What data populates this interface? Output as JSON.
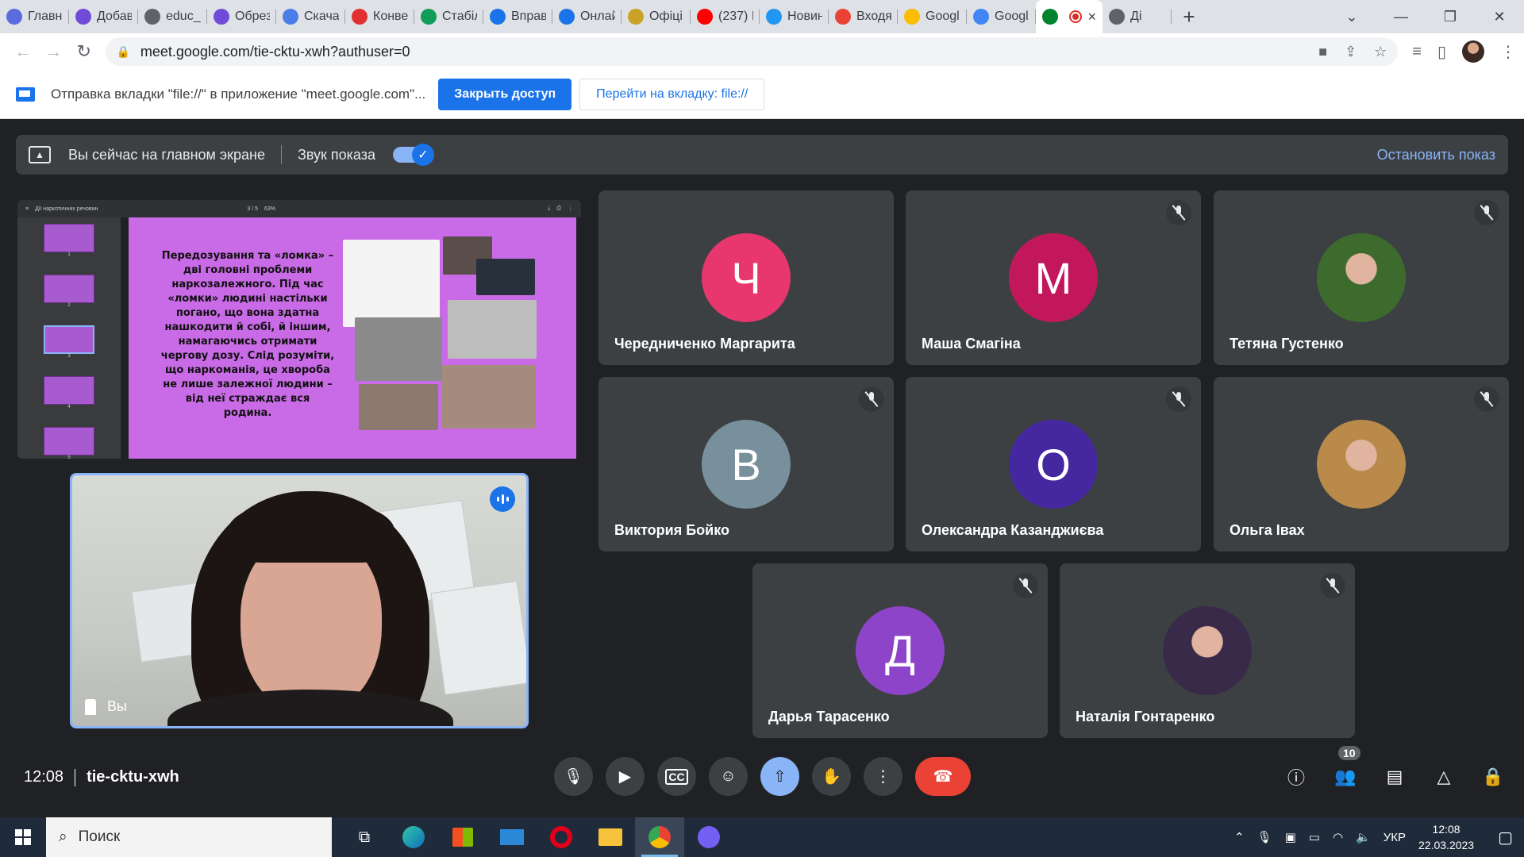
{
  "browser": {
    "tabs": [
      {
        "label": "Главн",
        "favicon_color": "#5b6be0"
      },
      {
        "label": "Добав",
        "favicon_color": "#6f4bd8"
      },
      {
        "label": "educ_",
        "favicon_color": "#5f6368"
      },
      {
        "label": "Обрез",
        "favicon_color": "#6f4bd8"
      },
      {
        "label": "Скача",
        "favicon_color": "#4a7ee6"
      },
      {
        "label": "Конве",
        "favicon_color": "#e03030"
      },
      {
        "label": "Стабіл",
        "favicon_color": "#0f9d58"
      },
      {
        "label": "Вправ",
        "favicon_color": "#1a73e8"
      },
      {
        "label": "Онлай",
        "favicon_color": "#1a73e8"
      },
      {
        "label": "Офіці",
        "favicon_color": "#c9a227"
      },
      {
        "label": "(237) I",
        "favicon_color": "#ff0000"
      },
      {
        "label": "Новин",
        "favicon_color": "#2196f3"
      },
      {
        "label": "Входя",
        "favicon_color": "#ea4335"
      },
      {
        "label": "Googl",
        "favicon_color": "#fbbc04"
      },
      {
        "label": "Googl",
        "favicon_color": "#4285f4"
      }
    ],
    "active_tab": {
      "label": "",
      "favicon_color": "#00832d"
    },
    "last_tab": {
      "label": "Ді",
      "favicon_color": "#5f6368"
    },
    "url": "meet.google.com/tie-cktu-xwh?authuser=0"
  },
  "infobar": {
    "message": "Отправка вкладки \"file://\" в приложение \"meet.google.com\"...",
    "primary_button": "Закрыть доступ",
    "secondary_button": "Перейти на вкладку: file://"
  },
  "present_bar": {
    "status": "Вы сейчас на главном экране",
    "sound_label": "Звук показа",
    "stop_label": "Остановить показ"
  },
  "slide": {
    "doc_title": "Дії наркотичних речовин",
    "page_indicator": "3 / 5",
    "zoom": "63%",
    "thumb_numbers": [
      "1",
      "2",
      "3",
      "4",
      "5"
    ],
    "text": "Передозування та «ломка» – дві головні проблеми наркозалежного. Під час «ломки» людині настільки погано, що вона здатна нашкодити й собі, й іншим, намагаючись отримати чергову дозу. Слід розуміти, що наркоманія, це хвороба не лише залежної людини – від неї страждає вся родина."
  },
  "self_view": {
    "label": "Вы"
  },
  "participants": [
    {
      "name": "Чередниченко Маргарита",
      "initial": "Ч",
      "color": "#e8366f",
      "muted": false,
      "photo": false
    },
    {
      "name": "Маша Смагіна",
      "initial": "М",
      "color": "#c2185b",
      "muted": true,
      "photo": false
    },
    {
      "name": "Тетяна Густенко",
      "initial": "",
      "color": "#3d6b2e",
      "muted": true,
      "photo": true
    },
    {
      "name": "Виктория Бойко",
      "initial": "В",
      "color": "#78909c",
      "muted": true,
      "photo": false
    },
    {
      "name": "Олександра Казанджиєва",
      "initial": "О",
      "color": "#4527a0",
      "muted": true,
      "photo": false
    },
    {
      "name": "Ольга Івах",
      "initial": "",
      "color": "#b98a4a",
      "muted": true,
      "photo": true
    },
    {
      "name": "Дарья Тарасенко",
      "initial": "Д",
      "color": "#8e44c8",
      "muted": true,
      "photo": false
    },
    {
      "name": "Наталія Гонтаренко",
      "initial": "",
      "color": "#3a2a4a",
      "muted": true,
      "photo": true
    }
  ],
  "meeting": {
    "time": "12:08",
    "code": "tie-cktu-xwh",
    "participant_count": "10"
  },
  "taskbar": {
    "search_placeholder": "Поиск",
    "language": "УКР",
    "clock_time": "12:08",
    "clock_date": "22.03.2023"
  }
}
